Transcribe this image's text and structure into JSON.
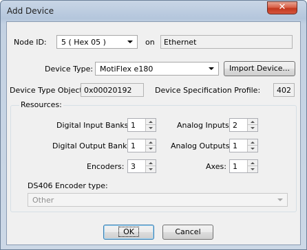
{
  "window": {
    "title": "Add Device",
    "close_glyph": "✕",
    "close_icon": "close-icon"
  },
  "node": {
    "label": "Node ID:",
    "value": "5   ( Hex 05 )",
    "on_label": "on",
    "network": "Ethernet"
  },
  "device_type": {
    "label": "Device Type:",
    "value": "MotiFlex e180",
    "import_button": "Import Device..."
  },
  "device_object": {
    "label": "Device Type Object:",
    "value": "0x00020192",
    "profile_label": "Device Specification Profile:",
    "profile_value": "402"
  },
  "resources": {
    "title": "Resources:",
    "digital_input_banks": {
      "label": "Digital Input Banks:",
      "value": "1"
    },
    "digital_output_banks": {
      "label": "Digital Output Banks:",
      "value": "1"
    },
    "encoders": {
      "label": "Encoders:",
      "value": "3"
    },
    "analog_inputs": {
      "label": "Analog Inputs:",
      "value": "2"
    },
    "analog_outputs": {
      "label": "Analog Outputs:",
      "value": "1"
    },
    "axes": {
      "label": "Axes:",
      "value": "1"
    },
    "encoder_type_label": "DS406 Encoder type:",
    "encoder_type_value": "Other"
  },
  "buttons": {
    "ok": "OK",
    "cancel": "Cancel"
  }
}
